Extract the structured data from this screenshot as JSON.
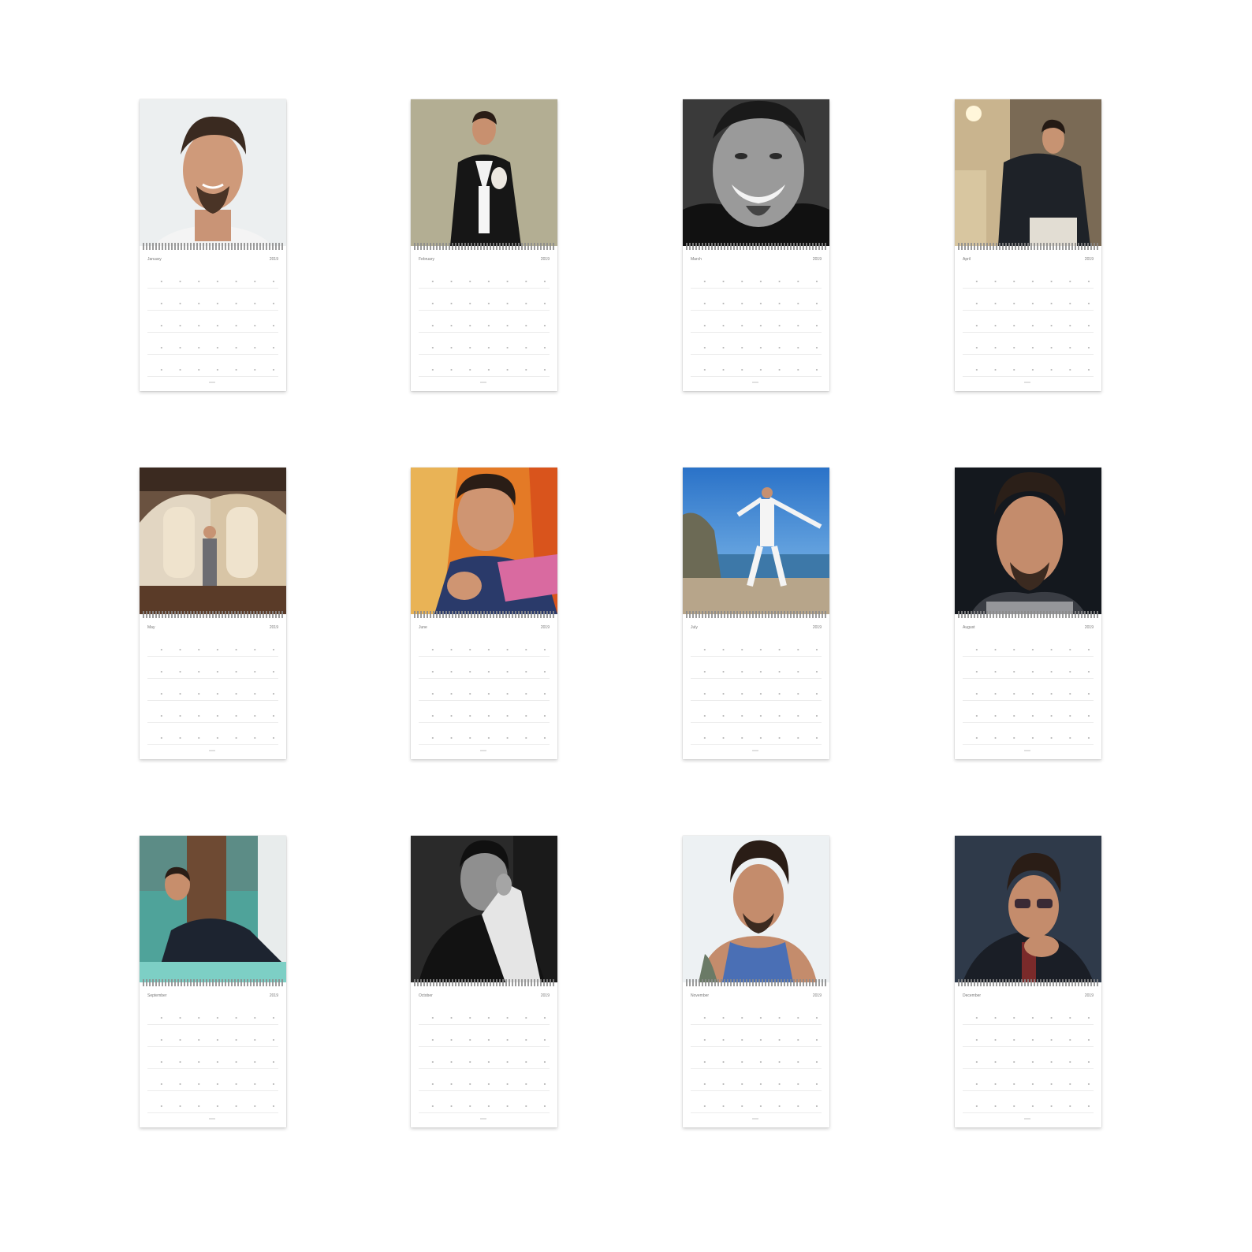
{
  "months": [
    {
      "name": "January",
      "year": "2019",
      "photo": "portrait-light-background"
    },
    {
      "name": "February",
      "year": "2019",
      "photo": "portrait-tuxedo"
    },
    {
      "name": "March",
      "year": "2019",
      "photo": "portrait-black-and-white-smile"
    },
    {
      "name": "April",
      "year": "2019",
      "photo": "portrait-leather-jacket"
    },
    {
      "name": "May",
      "year": "2019",
      "photo": "portrait-car-interior"
    },
    {
      "name": "June",
      "year": "2019",
      "photo": "portrait-orange-chair"
    },
    {
      "name": "July",
      "year": "2019",
      "photo": "portrait-seaside"
    },
    {
      "name": "August",
      "year": "2019",
      "photo": "portrait-dark-background"
    },
    {
      "name": "September",
      "year": "2019",
      "photo": "portrait-teal-room"
    },
    {
      "name": "October",
      "year": "2019",
      "photo": "portrait-black-and-white-hand"
    },
    {
      "name": "November",
      "year": "2019",
      "photo": "portrait-blue-tank-top"
    },
    {
      "name": "December",
      "year": "2019",
      "photo": "portrait-sunglasses"
    }
  ]
}
